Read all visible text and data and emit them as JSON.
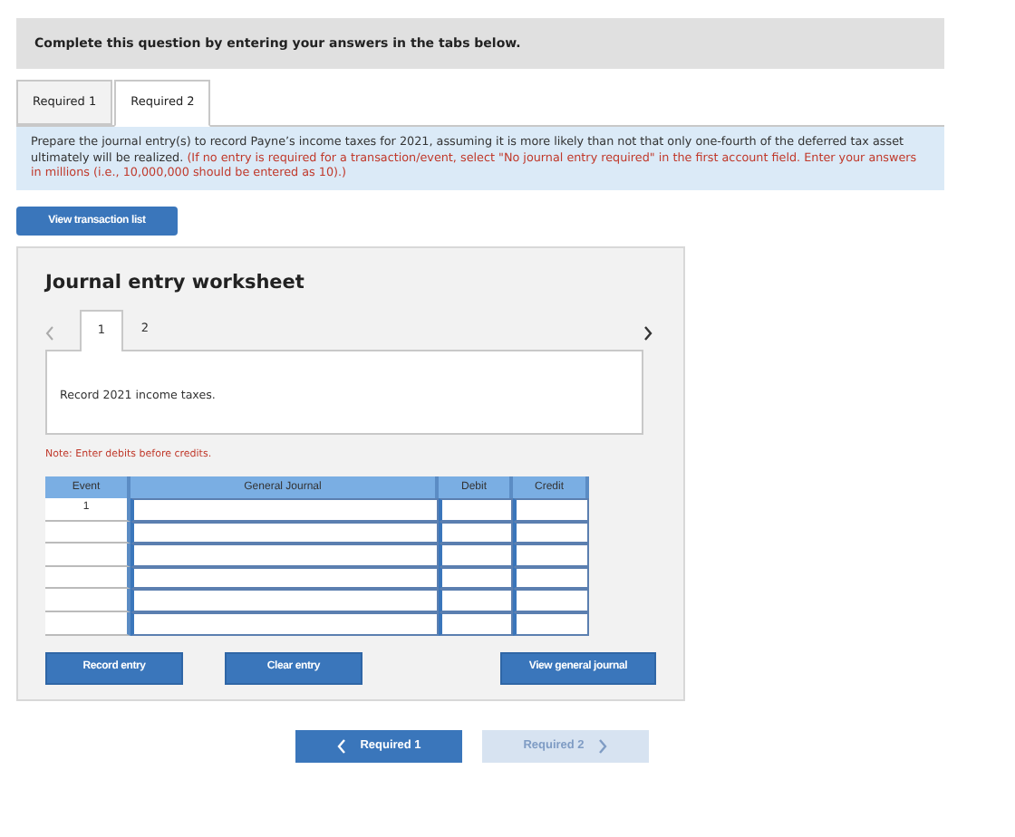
{
  "banner": "Complete this question by entering your answers in the tabs below.",
  "tabs": [
    {
      "label": "Required 1",
      "selected": false
    },
    {
      "label": "Required 2",
      "selected": true
    }
  ],
  "instructions": {
    "text": "Prepare the journal entry(s) to record Payne’s income taxes for 2021, assuming it is more likely than not that only one-fourth of the deferred tax asset ultimately will be realized.",
    "note": "(If no entry is required for a transaction/event, select \"No journal entry required\" in the first account field. Enter your answers in millions (i.e., 10,000,000 should be entered as 10).)"
  },
  "view_transaction_list": "View transaction list",
  "worksheet": {
    "title": "Journal entry worksheet",
    "pages": [
      {
        "label": "1",
        "selected": true
      },
      {
        "label": "2",
        "selected": false
      }
    ],
    "description": "Record 2021 income taxes.",
    "note": "Note: Enter debits before credits.",
    "columns": [
      "Event",
      "General Journal",
      "Debit",
      "Credit"
    ],
    "rows": [
      {
        "event": "1"
      },
      {},
      {},
      {},
      {},
      {}
    ],
    "buttons": [
      "Record entry",
      "Clear entry",
      "View general journal"
    ]
  },
  "nav": [
    {
      "label": "Required 1",
      "kind": "prev",
      "disabled": false
    },
    {
      "label": "Required 2",
      "kind": "next",
      "disabled": true
    }
  ]
}
